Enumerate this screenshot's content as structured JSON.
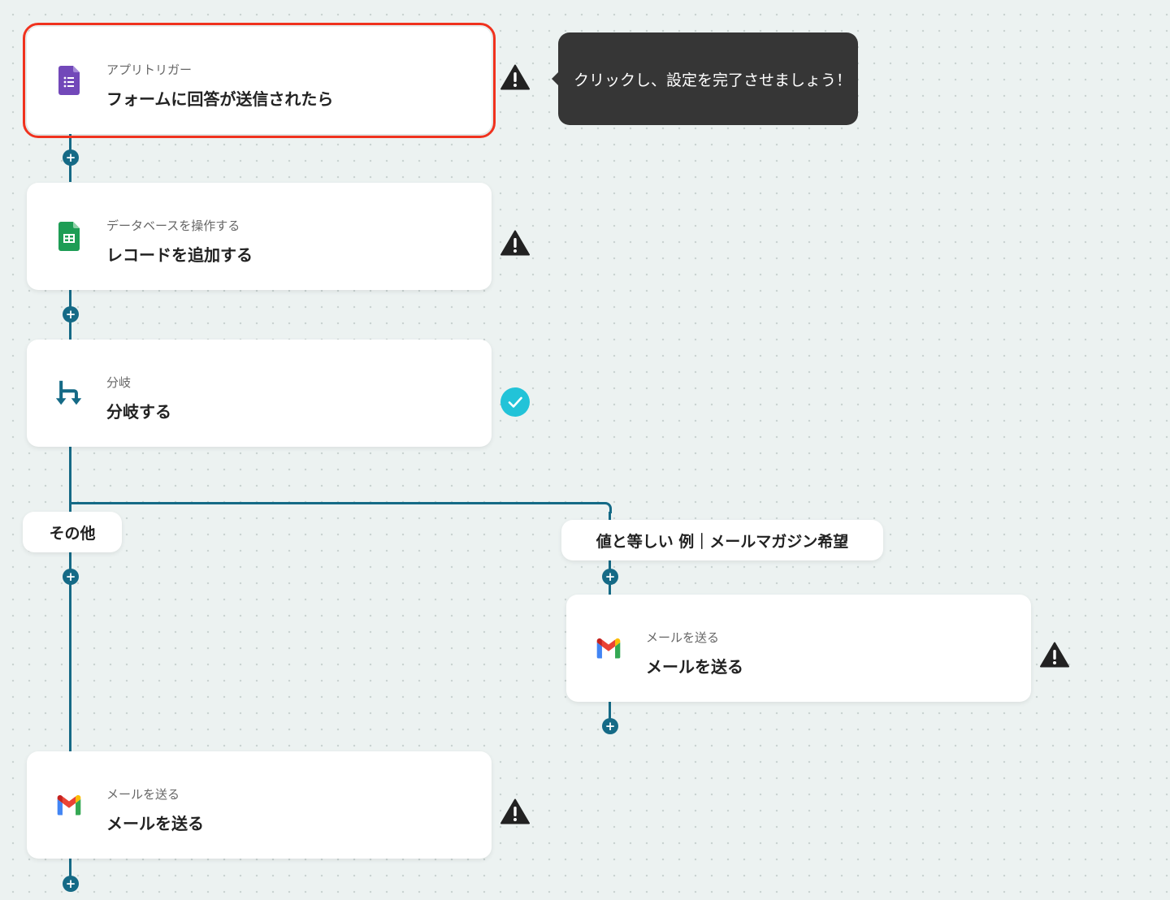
{
  "canvas": {
    "tooltip": "クリックし、設定を完了させましょう！",
    "steps": [
      {
        "subtitle": "アプリトリガー",
        "title": "フォームに回答が送信されたら",
        "icon": "google-forms-icon",
        "status": "warning"
      },
      {
        "subtitle": "データベースを操作する",
        "title": "レコードを追加する",
        "icon": "google-sheets-icon",
        "status": "warning"
      },
      {
        "subtitle": "分岐",
        "title": "分岐する",
        "icon": "branch-icon",
        "status": "complete"
      }
    ],
    "branches": {
      "other": {
        "label": "その他",
        "step": {
          "subtitle": "メールを送る",
          "title": "メールを送る",
          "icon": "gmail-icon",
          "status": "warning"
        }
      },
      "condition": {
        "label": "値と等しい 例｜メールマガジン希望",
        "step": {
          "subtitle": "メールを送る",
          "title": "メールを送る",
          "icon": "gmail-icon",
          "status": "warning"
        }
      }
    },
    "add_step_symbol": "+"
  },
  "colors": {
    "connector": "#156a86",
    "selected_outline": "#f0321e",
    "tooltip_bg": "#363636",
    "complete": "#22c3d8",
    "warning": "#222222"
  }
}
